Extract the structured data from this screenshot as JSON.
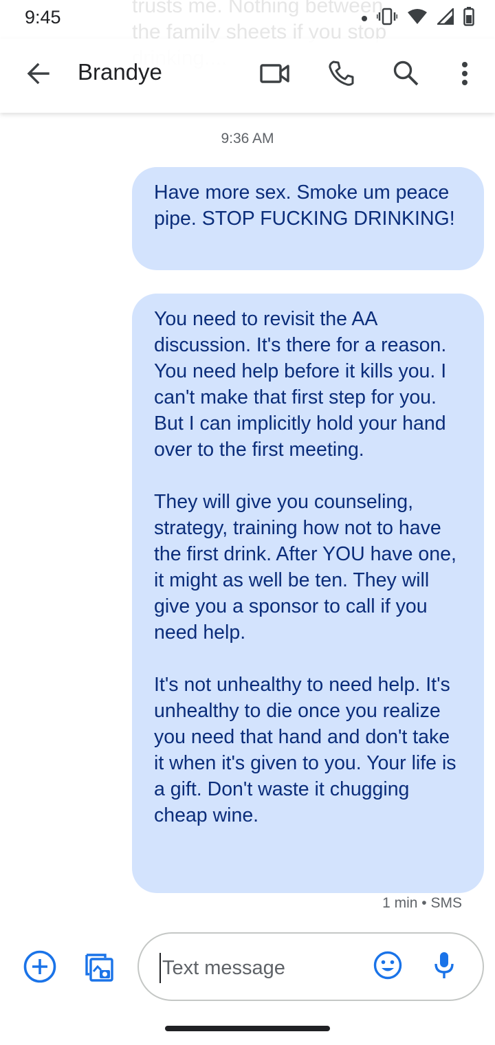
{
  "status_bar": {
    "time": "9:45"
  },
  "notification_ghost": {
    "text": "trusts me. Nothing between\nthe family sheets if you stop\ndrinking...."
  },
  "app_bar": {
    "contact_name": "Brandye",
    "icons": [
      "back-arrow-icon",
      "video-call-icon",
      "phone-icon",
      "search-icon",
      "more-vert-icon"
    ]
  },
  "conversation": {
    "timestamp": "9:36 AM",
    "messages": [
      {
        "text": "Have more sex. Smoke um peace pipe. STOP FUCKING DRINKING!"
      },
      {
        "text": "You need to revisit the AA discussion. It's there for a reason. You need help before it kills you. I can't make that first step for you. But I can implicitly hold your hand over to the first meeting.\n\nThey will give you counseling, strategy, training how not to have the first drink. After YOU have one, it might as well be ten. They will give you a sponsor to call if you need help.\n\nIt's not unhealthy to need help. It's unhealthy to die once you realize you need that hand and don't take it when it's given to you. Your life is a gift. Don't waste it chugging cheap wine."
      }
    ],
    "last_meta": "1 min • SMS"
  },
  "composer": {
    "placeholder": "Text message",
    "value": ""
  },
  "colors": {
    "bubble_bg": "#d3e3fd",
    "bubble_text": "#0b2d7a",
    "accent": "#1a73e8"
  }
}
